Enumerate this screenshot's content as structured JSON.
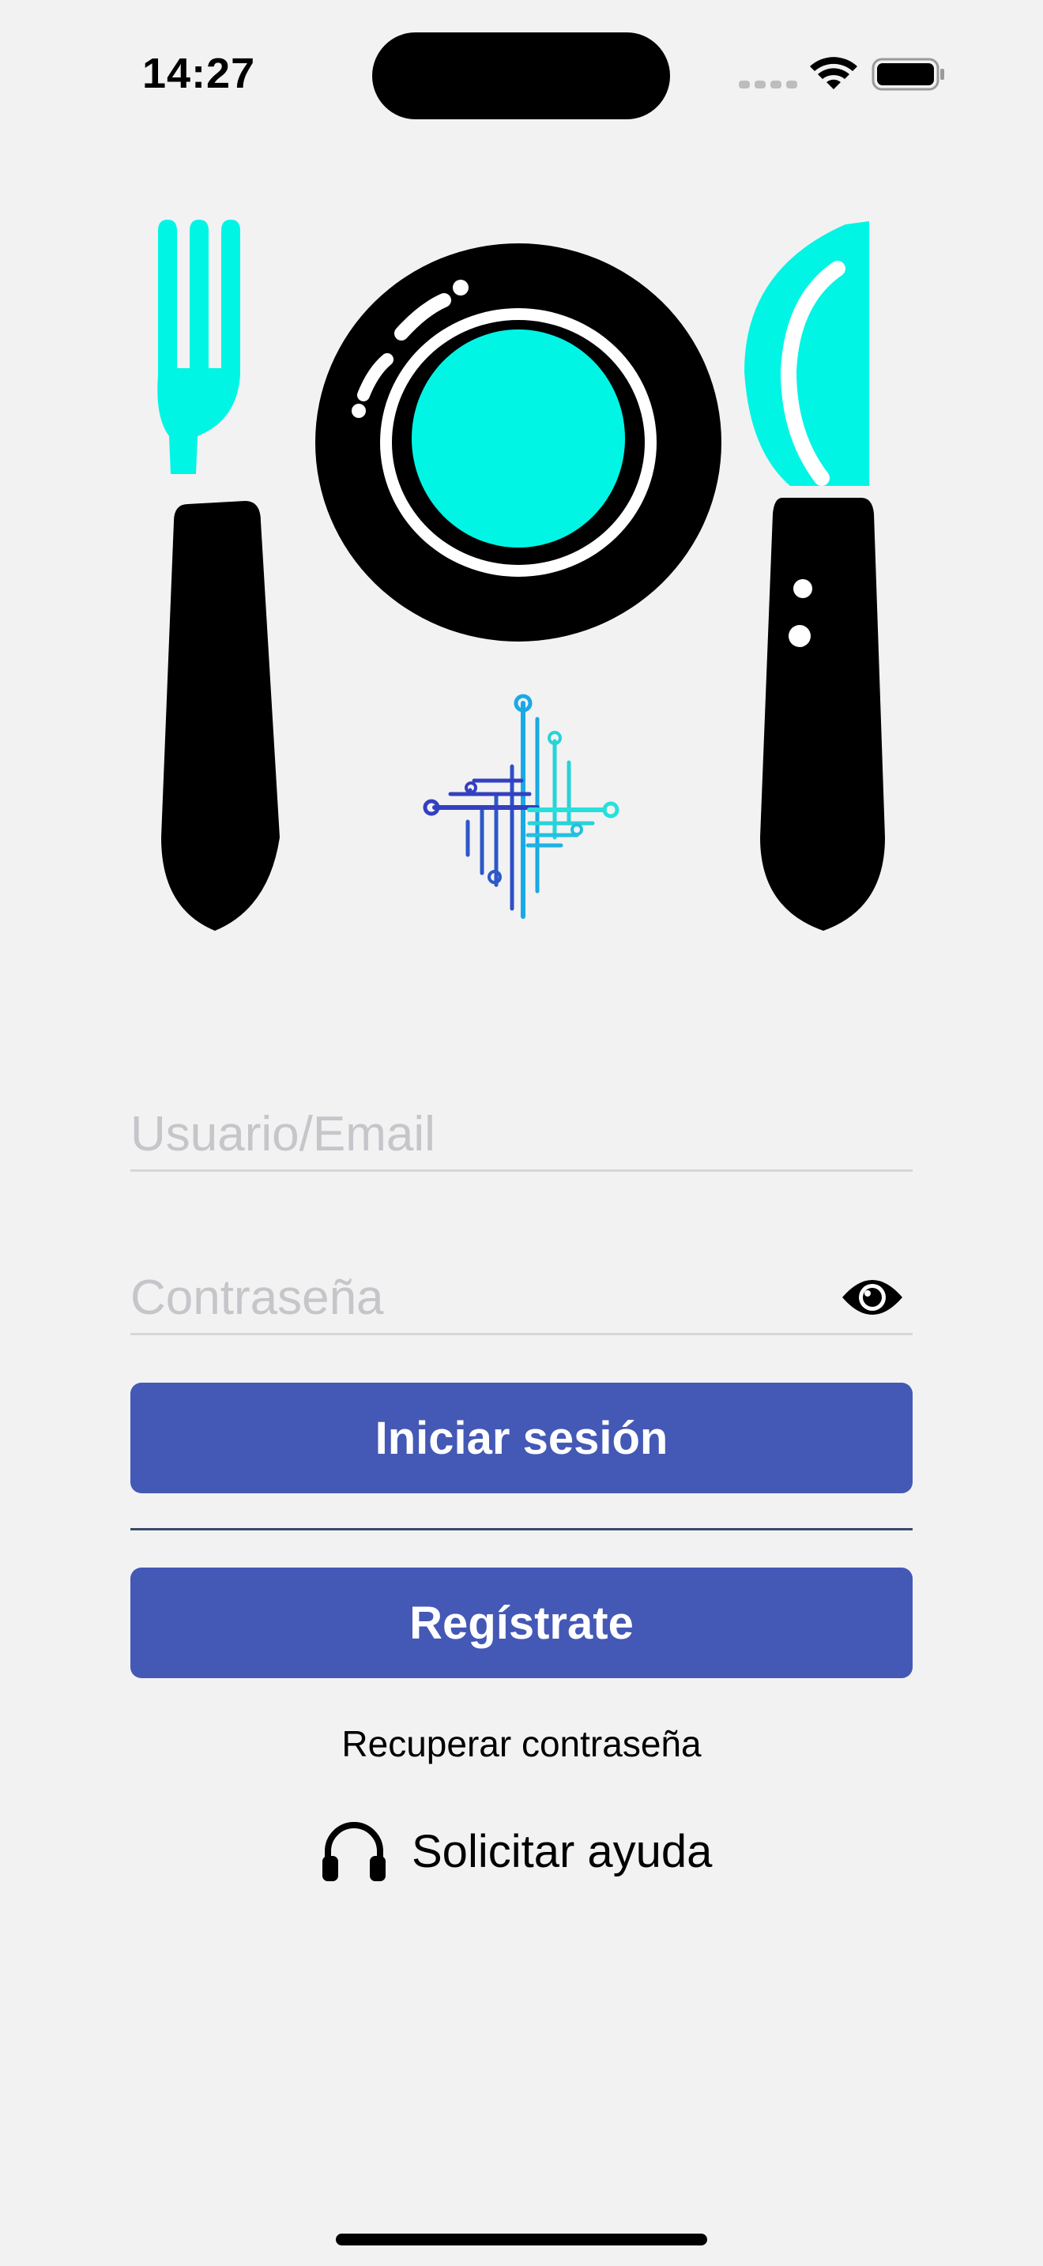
{
  "status_bar": {
    "time": "14:27"
  },
  "login": {
    "username_placeholder": "Usuario/Email",
    "username_value": "",
    "password_placeholder": "Contraseña",
    "password_value": "",
    "login_button_label": "Iniciar sesión",
    "register_button_label": "Regístrate",
    "recover_password_label": "Recuperar contraseña",
    "help_label": "Solicitar ayuda"
  },
  "icons": {
    "logo": "fork-plate-knife-circuit-logo",
    "password_toggle": "eye-icon",
    "help": "headphones-icon"
  },
  "colors": {
    "background": "#f2f2f2",
    "button": "#4458b5",
    "accent": "#00f5e4",
    "logo_dark": "#000000"
  }
}
